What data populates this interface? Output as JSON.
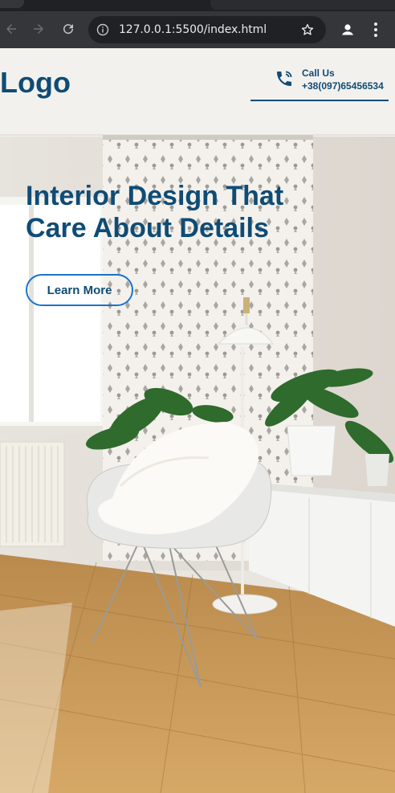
{
  "browser": {
    "url": "127.0.0.1:5500/index.html",
    "icons": [
      "back-icon",
      "forward-icon",
      "reload-icon",
      "info-icon",
      "star-icon",
      "profile-icon",
      "menu-icon"
    ]
  },
  "header": {
    "logo": "Logo",
    "call_label": "Call Us",
    "phone": "+38(097)65456534"
  },
  "hero": {
    "title": "Interior Design That Care About Details",
    "cta_label": "Learn More"
  },
  "colors": {
    "brand": "#0f4c75",
    "button_border": "#1a73c8",
    "chrome_bg": "#35363a",
    "omnibox_bg": "#202124"
  }
}
